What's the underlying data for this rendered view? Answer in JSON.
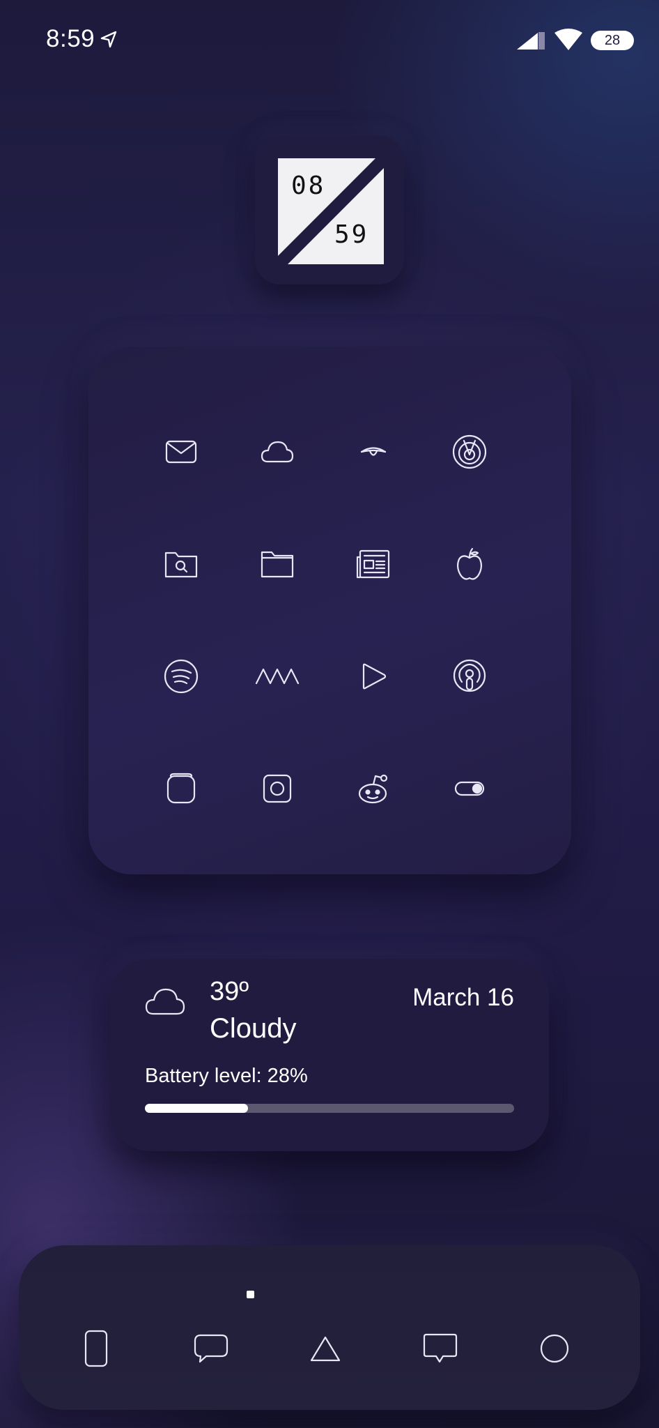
{
  "status_bar": {
    "time": "8:59",
    "battery": "28",
    "icons": [
      "location-arrow-icon",
      "cellular-signal-icon",
      "wifi-icon",
      "battery-pill"
    ]
  },
  "clock_widget": {
    "hour": "08",
    "minute": "59"
  },
  "app_grid": {
    "icons": [
      "mail-icon",
      "cloud-icon",
      "eye-icon",
      "radar-icon",
      "folder-search-icon",
      "folder-icon",
      "newspaper-icon",
      "apple-icon",
      "spotify-icon",
      "zigzag-icon",
      "play-icon",
      "podcast-icon",
      "rounded-square-icon",
      "instagram-icon",
      "reddit-icon",
      "toggle-icon"
    ]
  },
  "weather_widget": {
    "temperature": "39º",
    "condition": "Cloudy",
    "date": "March 16",
    "battery_label": "Battery level: 28%",
    "battery_level": 0.28
  },
  "dock": {
    "page_indicator": "1",
    "icons": [
      "phone-icon",
      "messages-icon",
      "triangle-icon",
      "chat-icon",
      "circle-icon"
    ]
  },
  "colors": {
    "background": "#221e48",
    "panel": "#211c3f",
    "icon_stroke": "#e9e6f5",
    "battery_track": "#5b5870",
    "battery_fill": "#ffffff"
  }
}
